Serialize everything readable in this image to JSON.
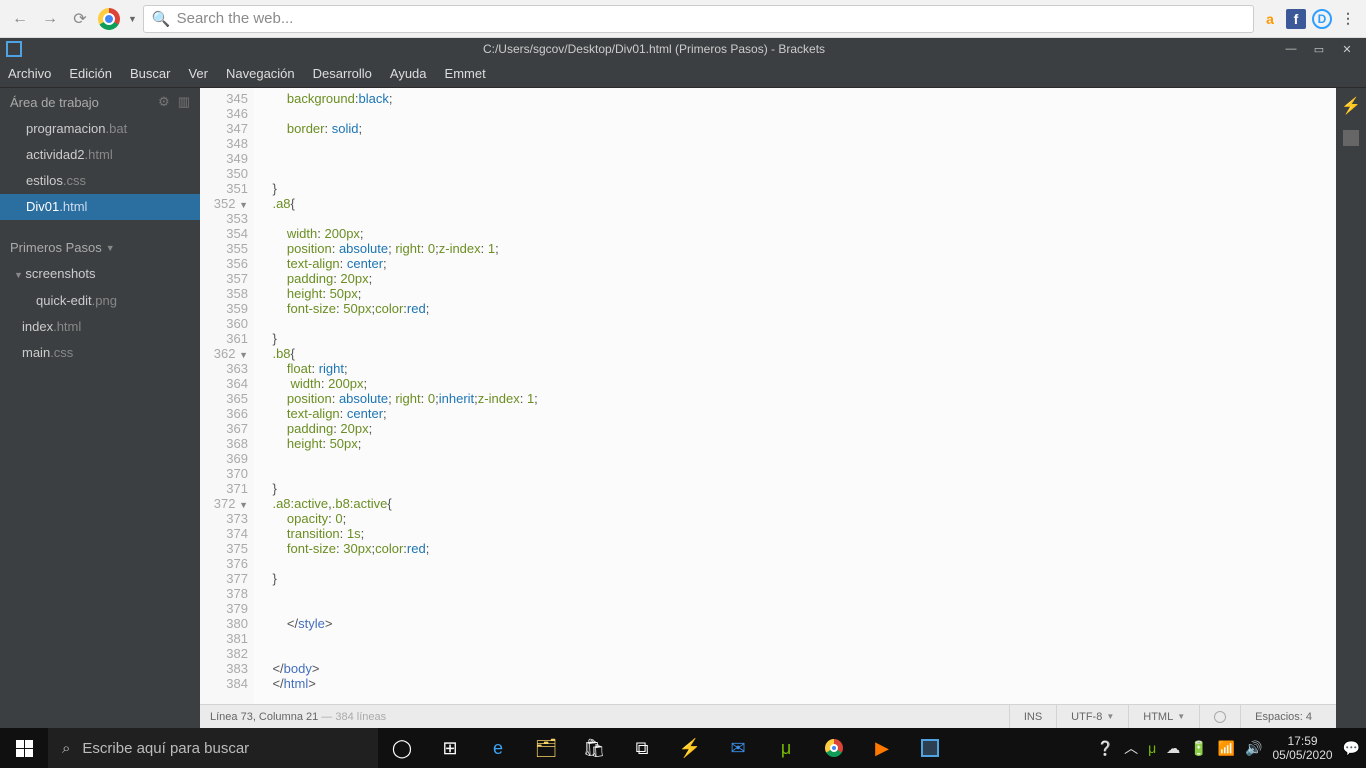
{
  "browser": {
    "search_placeholder": "Search the web...",
    "ext_amazon": "a",
    "ext_fb": "f",
    "ext_disqus": "D",
    "ext_more": "⋮"
  },
  "brackets": {
    "title": "C:/Users/sgcov/Desktop/Div01.html (Primeros Pasos) - Brackets",
    "menu": [
      "Archivo",
      "Edición",
      "Buscar",
      "Ver",
      "Navegación",
      "Desarrollo",
      "Ayuda",
      "Emmet"
    ],
    "workspace_label": "Área de trabajo",
    "files": [
      {
        "name": "programacion",
        "ext": ".bat"
      },
      {
        "name": "actividad2",
        "ext": ".html"
      },
      {
        "name": "estilos",
        "ext": ".css"
      },
      {
        "name": "Div01",
        "ext": ".html"
      }
    ],
    "active_file_index": 3,
    "project_name": "Primeros Pasos",
    "project_tree": [
      {
        "name": "screenshots",
        "ext": "",
        "folder": true
      },
      {
        "name": "quick-edit",
        "ext": ".png",
        "indent": true
      },
      {
        "name": "index",
        "ext": ".html"
      },
      {
        "name": "main",
        "ext": ".css"
      }
    ],
    "lines": [
      {
        "n": 345,
        "html": "        <span class='c-prop'>background</span>:<span class='c-val'>black</span>;"
      },
      {
        "n": 346,
        "html": ""
      },
      {
        "n": 347,
        "html": "        <span class='c-prop'>border</span>: <span class='c-val'>solid</span>;"
      },
      {
        "n": 348,
        "html": ""
      },
      {
        "n": 349,
        "html": ""
      },
      {
        "n": 350,
        "html": ""
      },
      {
        "n": 351,
        "html": "    }"
      },
      {
        "n": 352,
        "fold": true,
        "html": "    <span class='c-sel'>.a8</span>{"
      },
      {
        "n": 353,
        "html": ""
      },
      {
        "n": 354,
        "html": "        <span class='c-prop'>width</span>: <span class='c-num'>200px</span>;"
      },
      {
        "n": 355,
        "html": "        <span class='c-prop'>position</span>: <span class='c-val'>absolute</span>; <span class='c-prop'>right</span>: <span class='c-num'>0</span>;<span class='c-prop'>z-index</span>: <span class='c-num'>1</span>;"
      },
      {
        "n": 356,
        "html": "        <span class='c-prop'>text-align</span>: <span class='c-val'>center</span>;"
      },
      {
        "n": 357,
        "html": "        <span class='c-prop'>padding</span>: <span class='c-num'>20px</span>;"
      },
      {
        "n": 358,
        "html": "        <span class='c-prop'>height</span>: <span class='c-num'>50px</span>;"
      },
      {
        "n": 359,
        "html": "        <span class='c-prop'>font-size</span>: <span class='c-num'>50px</span>;<span class='c-prop'>color</span>:<span class='c-val'>red</span>;"
      },
      {
        "n": 360,
        "html": ""
      },
      {
        "n": 361,
        "html": "    }"
      },
      {
        "n": 362,
        "fold": true,
        "html": "    <span class='c-sel'>.b8</span>{"
      },
      {
        "n": 363,
        "html": "        <span class='c-prop'>float</span>: <span class='c-val'>right</span>;"
      },
      {
        "n": 364,
        "html": "         <span class='c-prop'>width</span>: <span class='c-num'>200px</span>;"
      },
      {
        "n": 365,
        "html": "        <span class='c-prop'>position</span>: <span class='c-val'>absolute</span>; <span class='c-prop'>right</span>: <span class='c-num'>0</span>;<span class='c-val'>inherit</span>;<span class='c-prop'>z-index</span>: <span class='c-num'>1</span>;"
      },
      {
        "n": 366,
        "html": "        <span class='c-prop'>text-align</span>: <span class='c-val'>center</span>;"
      },
      {
        "n": 367,
        "html": "        <span class='c-prop'>padding</span>: <span class='c-num'>20px</span>;"
      },
      {
        "n": 368,
        "html": "        <span class='c-prop'>height</span>: <span class='c-num'>50px</span>;"
      },
      {
        "n": 369,
        "html": ""
      },
      {
        "n": 370,
        "html": ""
      },
      {
        "n": 371,
        "html": "    }"
      },
      {
        "n": 372,
        "fold": true,
        "html": "    <span class='c-sel'>.a8:active</span>,<span class='c-sel'>.b8:active</span>{"
      },
      {
        "n": 373,
        "html": "        <span class='c-prop'>opacity</span>: <span class='c-num'>0</span>;"
      },
      {
        "n": 374,
        "html": "        <span class='c-prop'>transition</span>: <span class='c-num'>1s</span>;"
      },
      {
        "n": 375,
        "html": "        <span class='c-prop'>font-size</span>: <span class='c-num'>30px</span>;<span class='c-prop'>color</span>:<span class='c-val'>red</span>;"
      },
      {
        "n": 376,
        "html": ""
      },
      {
        "n": 377,
        "html": "    }"
      },
      {
        "n": 378,
        "html": ""
      },
      {
        "n": 379,
        "html": ""
      },
      {
        "n": 380,
        "html": "        &lt;/<span class='c-tag'>style</span>&gt;"
      },
      {
        "n": 381,
        "html": ""
      },
      {
        "n": 382,
        "html": ""
      },
      {
        "n": 383,
        "html": "    &lt;/<span class='c-tag'>body</span>&gt;"
      },
      {
        "n": 384,
        "html": "    &lt;/<span class='c-tag'>html</span>&gt;"
      }
    ],
    "status_left_a": "Línea 73, Columna 21",
    "status_left_b": " — 384 líneas",
    "status_ins": "INS",
    "status_enc": "UTF-8",
    "status_lang": "HTML",
    "status_spaces": "Espacios: 4"
  },
  "taskbar": {
    "search_placeholder": "Escribe aquí para buscar",
    "time": "17:59",
    "date": "05/05/2020"
  }
}
